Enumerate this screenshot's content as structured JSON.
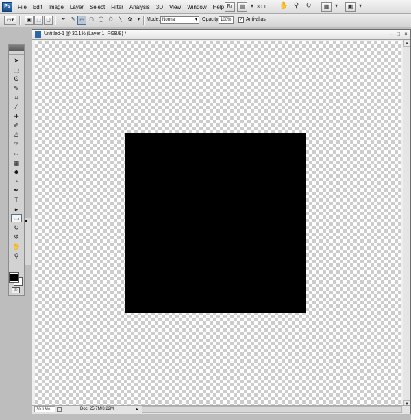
{
  "app": {
    "logo_text": "Ps"
  },
  "menubar": {
    "items": [
      "File",
      "Edit",
      "Image",
      "Layer",
      "Select",
      "Filter",
      "Analysis",
      "3D",
      "View",
      "Window",
      "Help"
    ],
    "zoom_display": "30.1",
    "icons": [
      "bridge-icon",
      "screen-mode-icon",
      "hand-icon",
      "zoom-icon",
      "rotate-view-icon",
      "arrange-documents-icon",
      "screen-mode-full-icon"
    ]
  },
  "options": {
    "mode_label": "Mode:",
    "mode_value": "Normal",
    "opacity_label": "Opacity:",
    "opacity_value": "100%",
    "antialias_label": "Anti-alias",
    "antialias_checked": "✓"
  },
  "document": {
    "title": "Untitled-1 @ 30.1% (Layer 1, RGB/8) *",
    "minimize": "–",
    "maximize": "□",
    "close": "×"
  },
  "status": {
    "zoom": "30.13%",
    "doc_info": "Doc: 25.7M/8.22M",
    "arrow": "▸"
  },
  "toolbox": {
    "tools": [
      {
        "name": "move-tool",
        "glyph": "➤"
      },
      {
        "name": "marquee-tool",
        "glyph": "⬚"
      },
      {
        "name": "lasso-tool",
        "glyph": "ʘ"
      },
      {
        "name": "quick-selection-tool",
        "glyph": "✎"
      },
      {
        "name": "crop-tool",
        "glyph": "⌗"
      },
      {
        "name": "eyedropper-tool",
        "glyph": "⁄"
      },
      {
        "name": "healing-brush-tool",
        "glyph": "✚"
      },
      {
        "name": "brush-tool",
        "glyph": "✐"
      },
      {
        "name": "clone-stamp-tool",
        "glyph": "♙"
      },
      {
        "name": "history-brush-tool",
        "glyph": "✑"
      },
      {
        "name": "eraser-tool",
        "glyph": "▱"
      },
      {
        "name": "gradient-tool",
        "glyph": "▦"
      },
      {
        "name": "blur-tool",
        "glyph": "◆"
      },
      {
        "name": "dodge-tool",
        "glyph": "◔"
      },
      {
        "name": "pen-tool",
        "glyph": "✒"
      },
      {
        "name": "type-tool",
        "glyph": "T"
      },
      {
        "name": "path-selection-tool",
        "glyph": "▸"
      },
      {
        "name": "rectangle-tool",
        "glyph": "▭"
      },
      {
        "name": "3d-rotate-tool",
        "glyph": "↻"
      },
      {
        "name": "3d-orbit-tool",
        "glyph": "↺"
      },
      {
        "name": "hand-tool",
        "glyph": "✋"
      },
      {
        "name": "zoom-tool",
        "glyph": "⚲"
      }
    ],
    "quick_mask": "◎"
  }
}
